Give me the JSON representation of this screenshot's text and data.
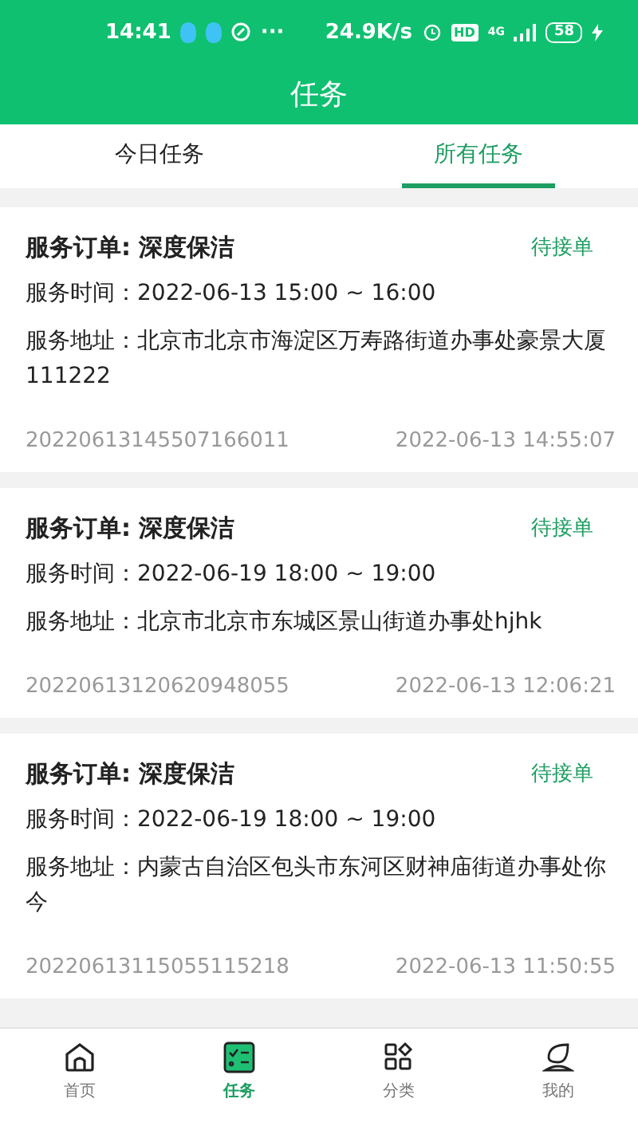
{
  "status_bar": {
    "time": "14:41",
    "more": "···",
    "speed": "24.9K/s",
    "hd": "HD",
    "network": "4G",
    "battery": "58"
  },
  "header": {
    "title": "任务"
  },
  "tabs": [
    {
      "label": "今日任务",
      "selected": false
    },
    {
      "label": "所有任务",
      "selected": true
    }
  ],
  "orders": [
    {
      "title": "服务订单: 深度保洁",
      "status": "待接单",
      "time_label": "服务时间：",
      "time": "2022-06-13 15:00 ~ 16:00",
      "address_label": "服务地址：",
      "address": "北京市北京市海淀区万寿路街道办事处豪景大厦111222",
      "order_no": "20220613145507166011",
      "created": "2022-06-13 14:55:07"
    },
    {
      "title": "服务订单: 深度保洁",
      "status": "待接单",
      "time_label": "服务时间：",
      "time": "2022-06-19 18:00 ~ 19:00",
      "address_label": "服务地址：",
      "address": "北京市北京市东城区景山街道办事处hjhk",
      "order_no": "20220613120620948055",
      "created": "2022-06-13 12:06:21"
    },
    {
      "title": "服务订单: 深度保洁",
      "status": "待接单",
      "time_label": "服务时间：",
      "time": "2022-06-19 18:00 ~ 19:00",
      "address_label": "服务地址：",
      "address": "内蒙古自治区包头市东河区财神庙街道办事处你今",
      "order_no": "20220613115055115218",
      "created": "2022-06-13 11:50:55"
    }
  ],
  "bottom_nav": [
    {
      "label": "首页",
      "kind": "home",
      "selected": false
    },
    {
      "label": "任务",
      "kind": "tasks",
      "selected": true
    },
    {
      "label": "分类",
      "kind": "category",
      "selected": false
    },
    {
      "label": "我的",
      "kind": "profile",
      "selected": false
    }
  ]
}
